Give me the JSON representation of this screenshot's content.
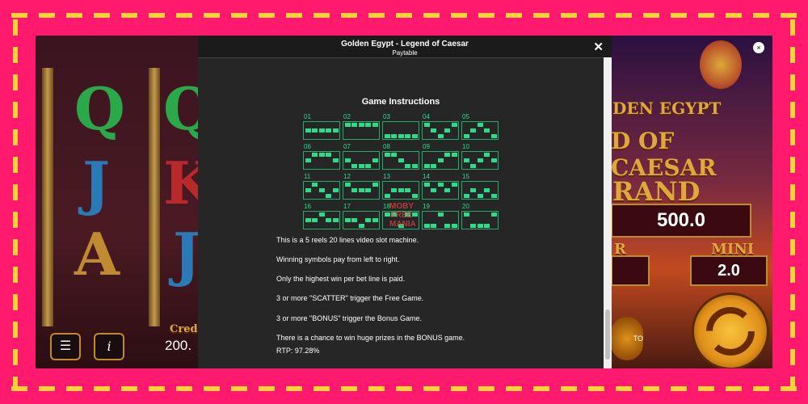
{
  "modal": {
    "title": "Golden Egypt - Legend of Caesar",
    "subtitle": "Paytable",
    "close_symbol": "✕",
    "heading": "Game Instructions",
    "paylines": [
      {
        "label": "01",
        "rows": [
          1,
          1,
          1,
          1,
          1
        ]
      },
      {
        "label": "02",
        "rows": [
          0,
          0,
          0,
          0,
          0
        ]
      },
      {
        "label": "03",
        "rows": [
          2,
          2,
          2,
          2,
          2
        ]
      },
      {
        "label": "04",
        "rows": [
          0,
          1,
          2,
          1,
          0
        ]
      },
      {
        "label": "05",
        "rows": [
          2,
          1,
          0,
          1,
          2
        ]
      },
      {
        "label": "06",
        "rows": [
          1,
          0,
          0,
          0,
          1
        ]
      },
      {
        "label": "07",
        "rows": [
          1,
          2,
          2,
          2,
          1
        ]
      },
      {
        "label": "08",
        "rows": [
          0,
          0,
          1,
          2,
          2
        ]
      },
      {
        "label": "09",
        "rows": [
          2,
          2,
          1,
          0,
          0
        ]
      },
      {
        "label": "10",
        "rows": [
          1,
          2,
          1,
          0,
          1
        ]
      },
      {
        "label": "11",
        "rows": [
          1,
          0,
          1,
          2,
          1
        ]
      },
      {
        "label": "12",
        "rows": [
          0,
          1,
          1,
          1,
          0
        ]
      },
      {
        "label": "13",
        "rows": [
          2,
          1,
          1,
          1,
          2
        ]
      },
      {
        "label": "14",
        "rows": [
          0,
          1,
          0,
          1,
          0
        ]
      },
      {
        "label": "15",
        "rows": [
          2,
          1,
          2,
          1,
          2
        ]
      },
      {
        "label": "16",
        "rows": [
          1,
          1,
          0,
          1,
          1
        ]
      },
      {
        "label": "17",
        "rows": [
          1,
          1,
          2,
          1,
          1
        ]
      },
      {
        "label": "18",
        "rows": [
          0,
          0,
          2,
          0,
          0
        ]
      },
      {
        "label": "19",
        "rows": [
          2,
          2,
          0,
          2,
          2
        ]
      },
      {
        "label": "20",
        "rows": [
          0,
          2,
          2,
          2,
          0
        ]
      }
    ],
    "instructions": [
      "This is a 5 reels 20 lines video slot machine.",
      "Winning symbols pay from left to right.",
      "Only the highest win per bet line is paid.",
      "3 or more \"SCATTER\" trigger the Free Game.",
      "3 or more \"BONUS\" trigger the Bonus Game.",
      "There is a chance to win huge prizes in the BONUS game."
    ],
    "rtp": "RTP: 97.28%"
  },
  "watermark": [
    "MOBY",
    "FREE",
    "MANIA"
  ],
  "background": {
    "credit_label": "Cred",
    "credit_value": "200.",
    "logo_line1": "DEN EGYPT",
    "logo_line2": "D OF CAESAR",
    "grand_label": "RAND",
    "grand_value": "500.0",
    "minor_label": "R",
    "mini_label": "MINI",
    "mini_value": "2.0",
    "auto_label": "TO",
    "reel_symbols": [
      "Q",
      "Q",
      "J",
      "K",
      "A",
      "J"
    ]
  },
  "colors": {
    "frame": "#ff1a6e",
    "dash": "#ffd23a",
    "payline": "#2bdc8a",
    "modal_bg": "#262626"
  },
  "icons": [
    "menu-icon",
    "info-icon",
    "close-icon",
    "spin-icon",
    "auto-icon"
  ]
}
